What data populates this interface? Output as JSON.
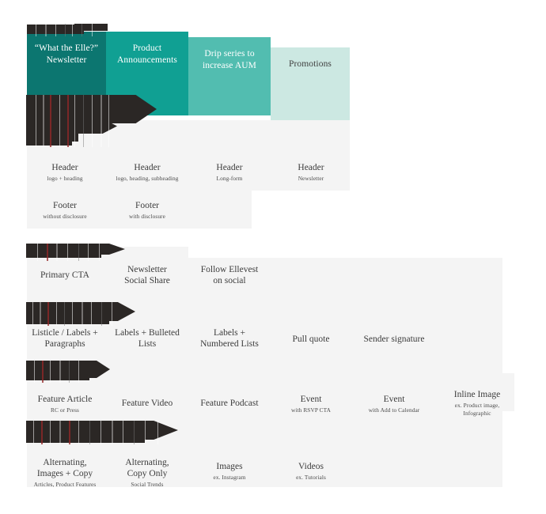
{
  "meta": {
    "page_title": "Email Template Taxonomy",
    "background": "#ffffff",
    "panel_gray": "#f4f4f4",
    "text_dark": "#3c3c3c"
  },
  "funnel": {
    "name": "campaign-funnel",
    "stages": [
      {
        "label": "“What the Elle?”\nNewsletter",
        "color": "#0c7670",
        "text_color": "#ffffff"
      },
      {
        "label": "Product\nAnnouncements",
        "color": "#10a093",
        "text_color": "#ffffff"
      },
      {
        "label": "Drip series to\nincrease AUM",
        "color": "#52bdb0",
        "text_color": "#ffffff"
      },
      {
        "label": "Promotions",
        "color": "#cce8e2",
        "text_color": "#3f3f3f"
      }
    ]
  },
  "module_groups": [
    {
      "name": "headers-footers",
      "rows": [
        {
          "name": "header-row",
          "cells": [
            {
              "title": "Header",
              "sub": "logo + heading"
            },
            {
              "title": "Header",
              "sub": "logo, heading, subheading"
            },
            {
              "title": "Header",
              "sub": "Long-form"
            },
            {
              "title": "Header",
              "sub": "Newsletter"
            }
          ]
        },
        {
          "name": "footer-row",
          "cells": [
            {
              "title": "Footer",
              "sub": "without disclosure"
            },
            {
              "title": "Footer",
              "sub": "with disclosure"
            }
          ]
        }
      ]
    },
    {
      "name": "content-modules",
      "rows": [
        {
          "name": "cta-row",
          "cells": [
            {
              "title": "Primary CTA",
              "sub": ""
            },
            {
              "title": "Newsletter\nSocial Share",
              "sub": ""
            },
            {
              "title": "Follow Ellevest\non social",
              "sub": ""
            }
          ]
        },
        {
          "name": "list-row",
          "cells": [
            {
              "title": "Listicle / Labels +\nParagraphs",
              "sub": ""
            },
            {
              "title": "Labels + Bulleted\nLists",
              "sub": ""
            },
            {
              "title": "Labels +\nNumbered Lists",
              "sub": ""
            },
            {
              "title": "Pull quote",
              "sub": ""
            },
            {
              "title": "Sender signature",
              "sub": ""
            }
          ]
        },
        {
          "name": "feature-row",
          "cells": [
            {
              "title": "Feature Article",
              "sub": "RC or Press"
            },
            {
              "title": "Feature Video",
              "sub": ""
            },
            {
              "title": "Feature Podcast",
              "sub": ""
            },
            {
              "title": "Event",
              "sub": "with RSVP CTA"
            },
            {
              "title": "Event",
              "sub": "with Add to Calendar"
            },
            {
              "title": "Inline Image",
              "sub": "ex. Product image,\nInfographic"
            }
          ]
        },
        {
          "name": "media-row",
          "cells": [
            {
              "title": "Alternating,\nImages + Copy",
              "sub": "Articles, Product Features"
            },
            {
              "title": "Alternating,\nCopy Only",
              "sub": "Social Trends"
            },
            {
              "title": "Images",
              "sub": "ex. Instagram"
            },
            {
              "title": "Videos",
              "sub": "ex. Tutorials"
            }
          ]
        }
      ]
    }
  ]
}
